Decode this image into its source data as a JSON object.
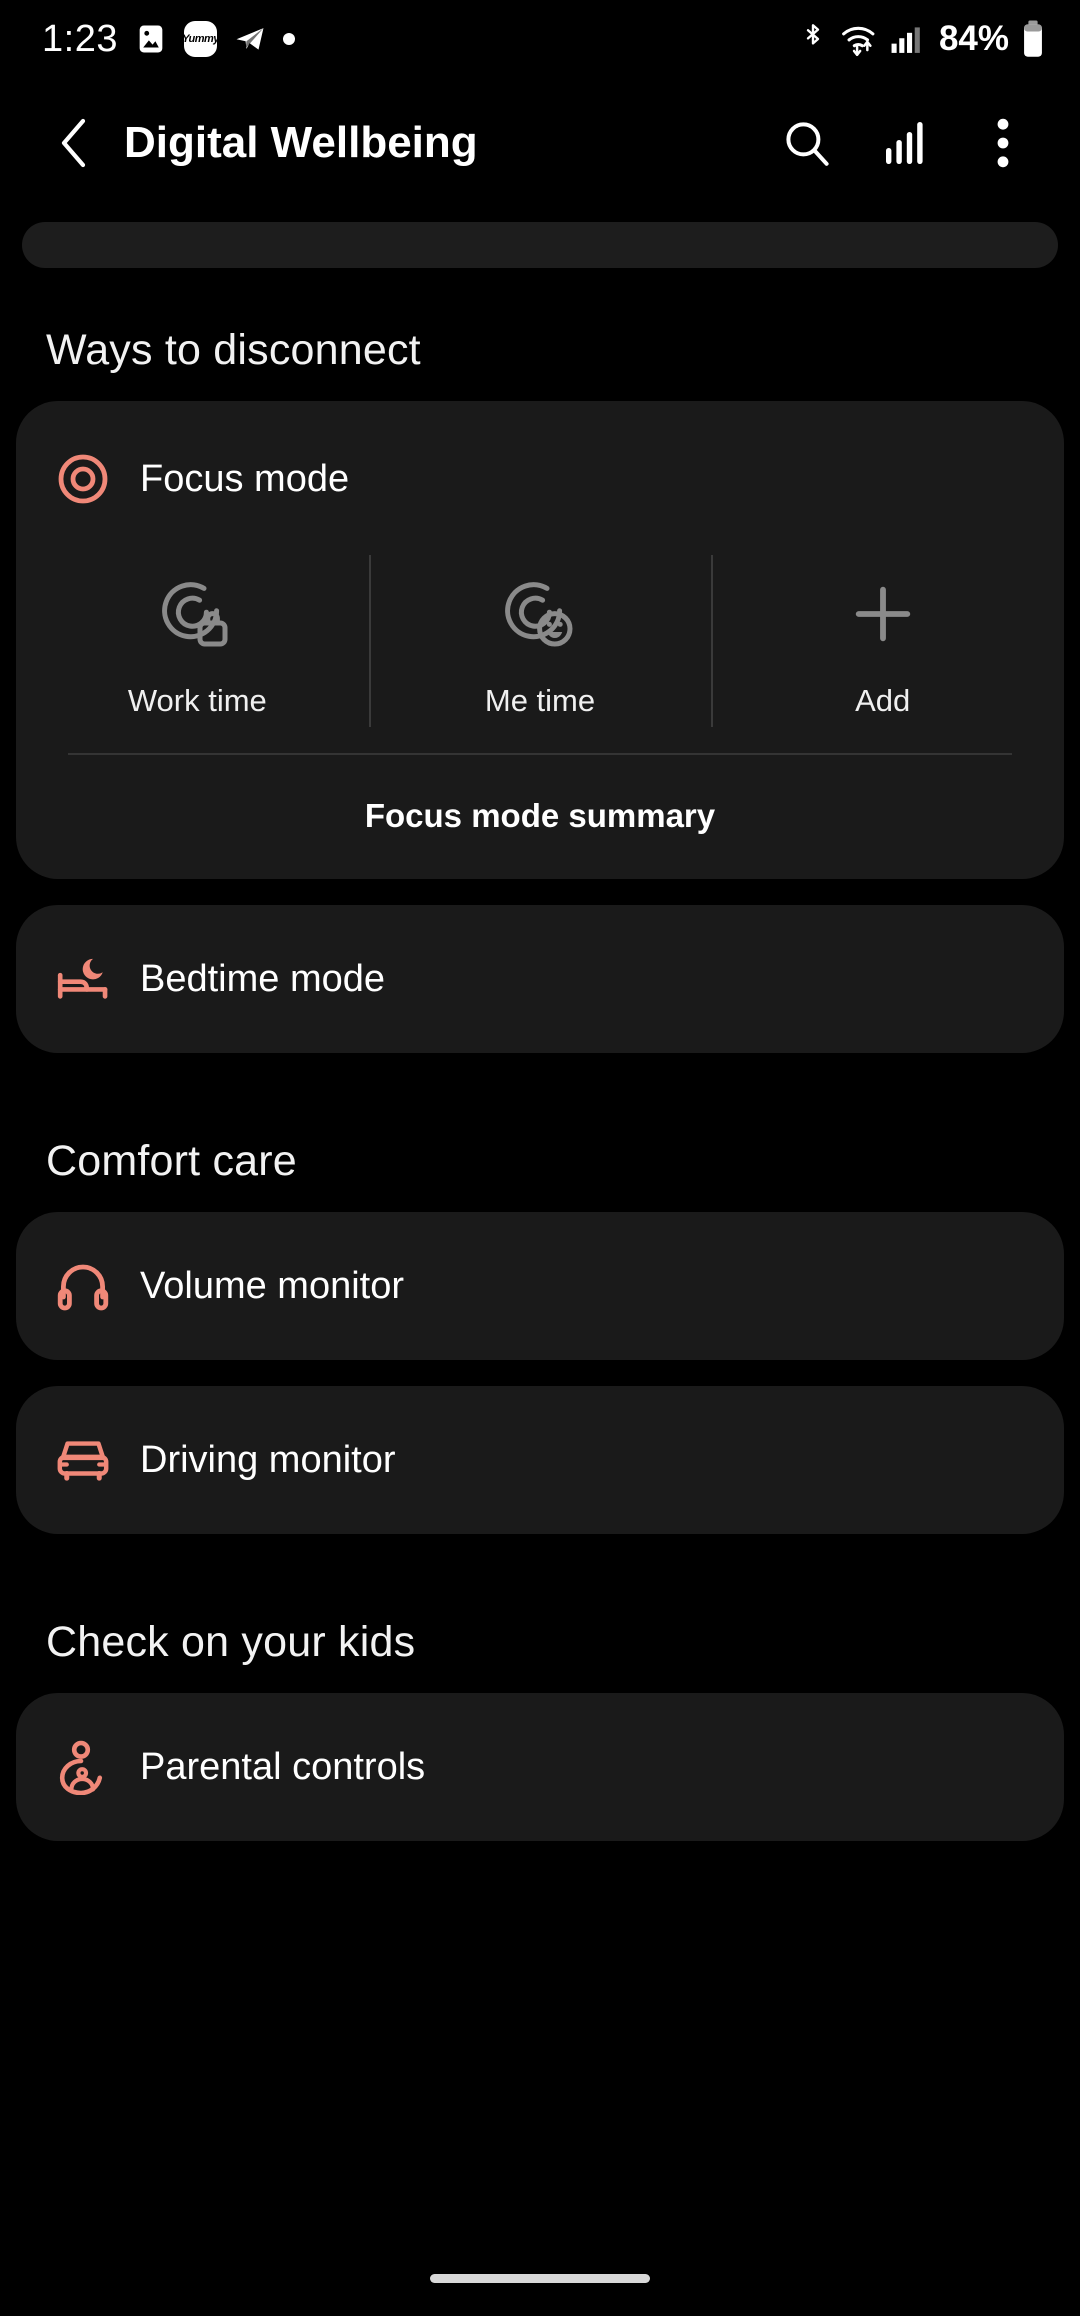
{
  "statusbar": {
    "time": "1:23",
    "battery_percent": "84%",
    "notification_icons": [
      "image-icon",
      "yummy-app-icon",
      "telegram-icon",
      "dot-icon"
    ],
    "system_icons": [
      "bluetooth-icon",
      "wifi-icon",
      "cellular-signal-icon",
      "battery-icon"
    ],
    "yummy_label": "Yummy"
  },
  "header": {
    "title": "Digital Wellbeing",
    "back_icon": "back-chevron-icon",
    "actions": [
      "search-icon",
      "bar-chart-icon",
      "more-options-icon"
    ]
  },
  "sections": [
    {
      "title": "Ways to disconnect",
      "items": [
        {
          "label": "Focus mode",
          "icon": "target-icon"
        },
        {
          "label": "Bedtime mode",
          "icon": "bed-moon-icon"
        }
      ]
    },
    {
      "title": "Comfort care",
      "items": [
        {
          "label": "Volume monitor",
          "icon": "headphones-icon"
        },
        {
          "label": "Driving monitor",
          "icon": "car-icon"
        }
      ]
    },
    {
      "title": "Check on your kids",
      "items": [
        {
          "label": "Parental controls",
          "icon": "parent-child-icon"
        }
      ]
    }
  ],
  "focus_mode": {
    "label": "Focus mode",
    "shortcuts": [
      {
        "label": "Work time",
        "icon": "target-briefcase-icon"
      },
      {
        "label": "Me time",
        "icon": "target-smiley-icon"
      },
      {
        "label": "Add",
        "icon": "plus-icon"
      }
    ],
    "summary_label": "Focus mode summary"
  },
  "colors": {
    "accent": "#f08878",
    "background": "#000000",
    "card": "#1a1a1a",
    "text_primary": "#ffffff",
    "icon_muted": "#8a8a8a"
  }
}
